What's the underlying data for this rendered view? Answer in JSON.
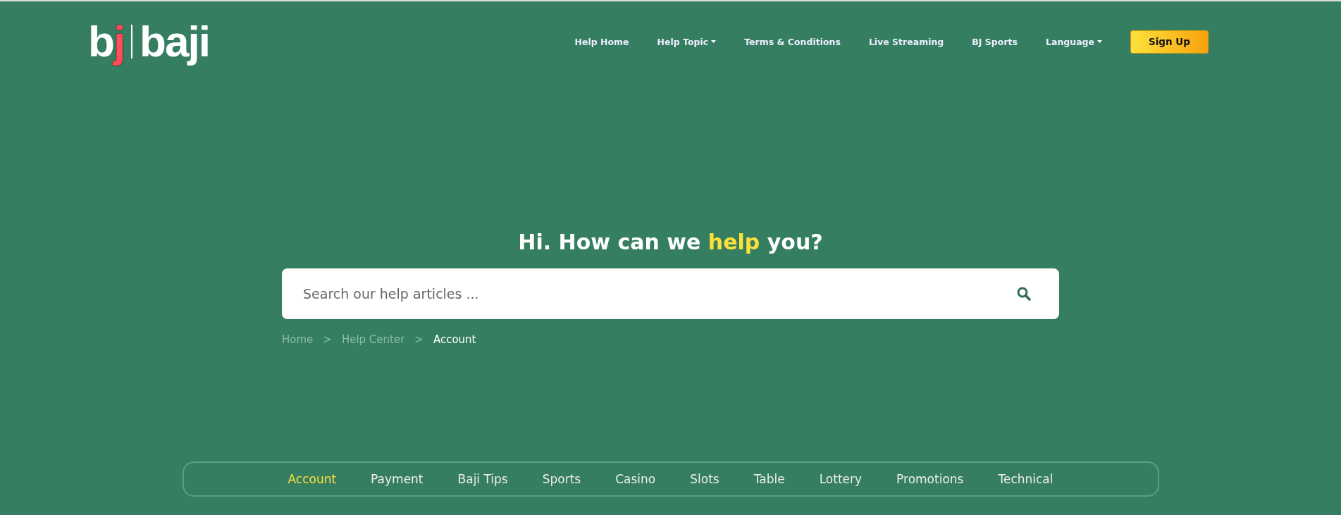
{
  "logo": {
    "mark_first": "b",
    "mark_accent": "j",
    "name": "baji"
  },
  "nav": [
    {
      "label": "Help Home",
      "dropdown": false
    },
    {
      "label": "Help Topic",
      "dropdown": true
    },
    {
      "label": "Terms & Conditions",
      "dropdown": false
    },
    {
      "label": "Live Streaming",
      "dropdown": false
    },
    {
      "label": "BJ Sports",
      "dropdown": false
    },
    {
      "label": "Language",
      "dropdown": true
    }
  ],
  "signup": "Sign Up",
  "heading": {
    "before": "Hi. How can we ",
    "highlight": "help",
    "after": " you?"
  },
  "search": {
    "placeholder": "Search our help articles ..."
  },
  "breadcrumb": [
    {
      "label": "Home",
      "current": false
    },
    {
      "label": "Help Center",
      "current": false
    },
    {
      "label": "Account",
      "current": true
    }
  ],
  "breadcrumb_separator": ">",
  "categories": [
    {
      "label": "Account",
      "selected": true
    },
    {
      "label": "Payment",
      "selected": false
    },
    {
      "label": "Baji Tips",
      "selected": false
    },
    {
      "label": "Sports",
      "selected": false
    },
    {
      "label": "Casino",
      "selected": false
    },
    {
      "label": "Slots",
      "selected": false
    },
    {
      "label": "Table",
      "selected": false
    },
    {
      "label": "Lottery",
      "selected": false
    },
    {
      "label": "Promotions",
      "selected": false
    },
    {
      "label": "Technical",
      "selected": false
    }
  ]
}
